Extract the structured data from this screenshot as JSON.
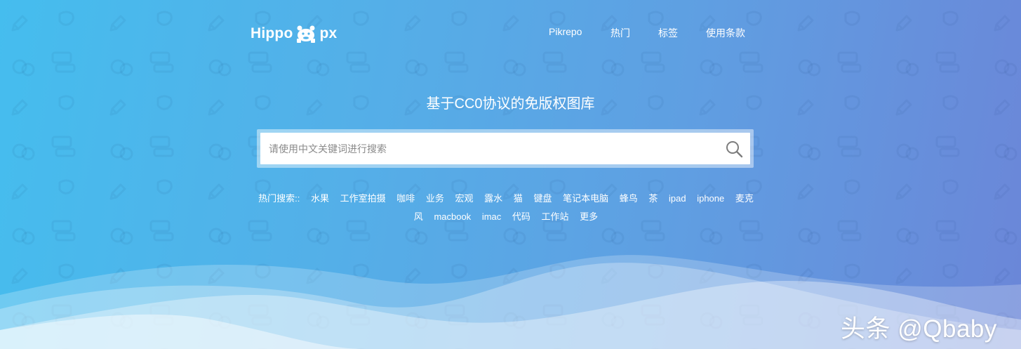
{
  "logo": {
    "left_text": "Hippo",
    "right_text": "px",
    "mascot_icon": "hippo-icon"
  },
  "nav": [
    {
      "label": "Pikrepo"
    },
    {
      "label": "热门"
    },
    {
      "label": "标签"
    },
    {
      "label": "使用条款"
    }
  ],
  "hero": {
    "title": "基于CC0协议的免版权图库"
  },
  "search": {
    "placeholder": "请使用中文关键词进行搜索",
    "value": "",
    "button_icon": "search-icon"
  },
  "hot_searches": {
    "label": "热门搜索::",
    "row1": [
      "水果",
      "工作室拍摄",
      "咖啡",
      "业务",
      "宏观",
      "露水",
      "猫",
      "键盘",
      "笔记本电脑",
      "蜂鸟",
      "茶",
      "ipad",
      "iphone",
      "麦克"
    ],
    "row2": [
      "风",
      "macbook",
      "imac",
      "代码",
      "工作站",
      "更多"
    ]
  },
  "watermark": "头条 @Qbaby",
  "colors": {
    "gradient_start": "#45bdee",
    "gradient_end": "#6b86d8",
    "text": "#ffffff"
  }
}
